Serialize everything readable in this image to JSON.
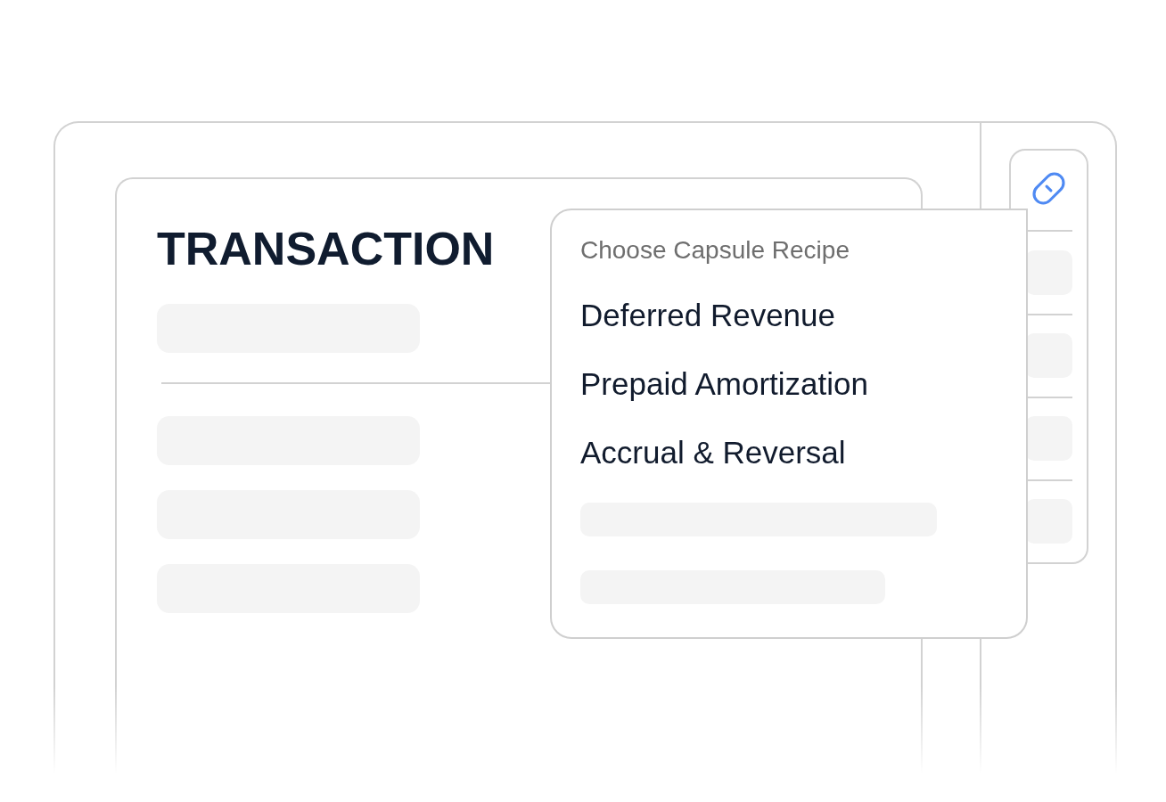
{
  "transaction_card": {
    "title": "TRANSACTION"
  },
  "recipe_menu": {
    "heading": "Choose Capsule Recipe",
    "options": [
      "Deferred Revenue",
      "Prepaid Amortization",
      "Accrual & Reversal"
    ]
  }
}
